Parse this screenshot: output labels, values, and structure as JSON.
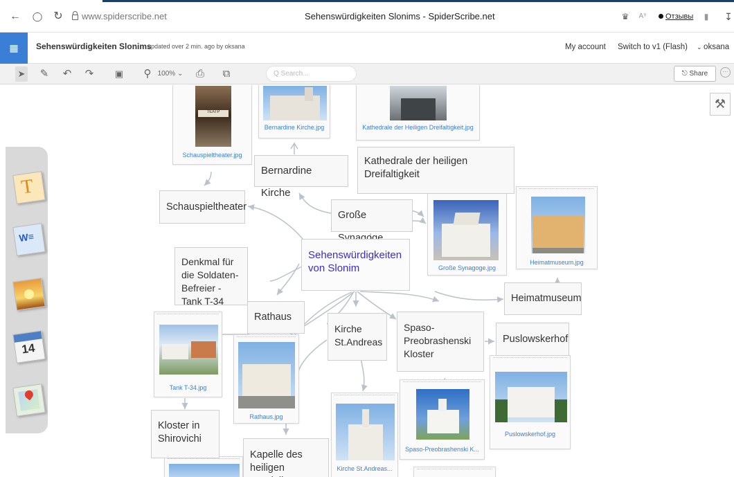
{
  "browser": {
    "url": "www.spiderscribe.net",
    "tab_title": "Sehenswürdigkeiten Slonims - SpiderScribe.net",
    "feedback": "Отзывы"
  },
  "app": {
    "title": "Sehenswürdigkeiten Slonims",
    "updated": "updated over 2 min. ago by oksana",
    "my_account": "My account",
    "switch_v1": "Switch to v1 (Flash)",
    "user": "oksana"
  },
  "toolbar": {
    "zoom": "100%",
    "search_placeholder": "Q Search...",
    "share": "Share"
  },
  "nodes": {
    "center": "Sehenswürdigkeiten von Slonim",
    "bernardine": "Bernardine Kirche",
    "kathedrale": "Kathedrale der heiligen Dreifaltigkeit",
    "schauspiel": "Schauspieltheater",
    "synagoge": "Große Synagoge",
    "denkmal": "Denkmal für die Soldaten-Befreier - Tank T-34",
    "rathaus": "Rathaus",
    "kirche_andreas": "Kirche St.Andreas",
    "spaso": "Spaso-Preobrashenski Kloster",
    "heimatmuseum": "Heimatmuseum",
    "puslowskerhof": "Puslowskerhof",
    "kloster_shirovichi": "Kloster in Shirovichi",
    "kapelle": "Kapelle des heiligen Dominiks"
  },
  "images": {
    "schauspiel": "Schauspieltheater.jpg",
    "bernardine": "Bernardine Kirche.jpg",
    "kathedrale": "Kathedrale der Heiligen Dreifaltigkeit.jpg",
    "synagoge": "Große Synagoge.jpg",
    "heimatmuseum": "Heimatmuseum.jpg",
    "tank": "Tank T-34.jpg",
    "rathaus": "Rathaus.jpg",
    "kirche_andreas": "Kirche St.Andreas...",
    "spaso": "Spaso-Preobrashenski K...",
    "puslowskerhof": "Puslowskerhof.jpg"
  },
  "theatre_sign": "ТЕАТР",
  "colors": {
    "accent": "#3a7ed5",
    "center_text": "#3a2bd2",
    "connector": "#b9c2ca"
  },
  "icons": [
    "back-icon",
    "tracking-icon",
    "reload-icon",
    "lock-icon",
    "grid-icon",
    "pointer-icon",
    "pen-icon",
    "undo-icon",
    "redo-icon",
    "frame-icon",
    "zoom-icon",
    "print-icon",
    "export-icon",
    "share-icon",
    "settings-icon",
    "text-tool-icon",
    "word-doc-icon",
    "image-tool-icon",
    "calendar-icon",
    "map-icon"
  ]
}
